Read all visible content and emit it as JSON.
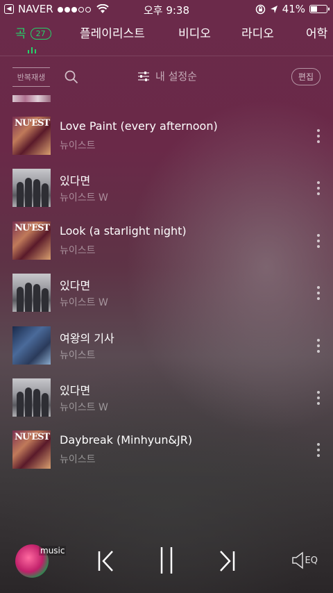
{
  "status_bar": {
    "back_icon": "back-arrow-icon",
    "carrier": "NAVER",
    "signal_dots_filled": 3,
    "signal_dots_total": 5,
    "time": "오후 9:38",
    "battery": "41%",
    "battery_level": 0.41
  },
  "tabs": [
    {
      "label": "곡",
      "count": "27",
      "active": true
    },
    {
      "label": "플레이리스트",
      "active": false
    },
    {
      "label": "비디오",
      "active": false
    },
    {
      "label": "라디오",
      "active": false
    },
    {
      "label": "어학",
      "active": false
    }
  ],
  "toolbar": {
    "repeat_label": "반복재생",
    "sort_label": "내 설정순",
    "edit_label": "편집"
  },
  "songs": [
    {
      "title": "Love Paint (every afternoon)",
      "artist": "뉴이스트",
      "cover": "nuest-album",
      "cover_text": "NU'EST"
    },
    {
      "title": "있다면",
      "artist": "뉴이스트 W",
      "cover": "nuest-w-album"
    },
    {
      "title": "Look (a starlight night)",
      "artist": "뉴이스트",
      "cover": "nuest-album",
      "cover_text": "NU'EST"
    },
    {
      "title": "있다면",
      "artist": "뉴이스트 W",
      "cover": "nuest-w-album"
    },
    {
      "title": "여왕의 기사",
      "artist": "뉴이스트",
      "cover": "queens-knight-album"
    },
    {
      "title": "있다면",
      "artist": "뉴이스트 W",
      "cover": "nuest-w-album"
    },
    {
      "title": "Daybreak (Minhyun&JR)",
      "artist": "뉴이스트",
      "cover": "nuest-album",
      "cover_text": "NU'EST"
    }
  ],
  "player": {
    "music_label": "music",
    "eq_label": "EQ"
  },
  "colors": {
    "accent": "#24d46a"
  }
}
